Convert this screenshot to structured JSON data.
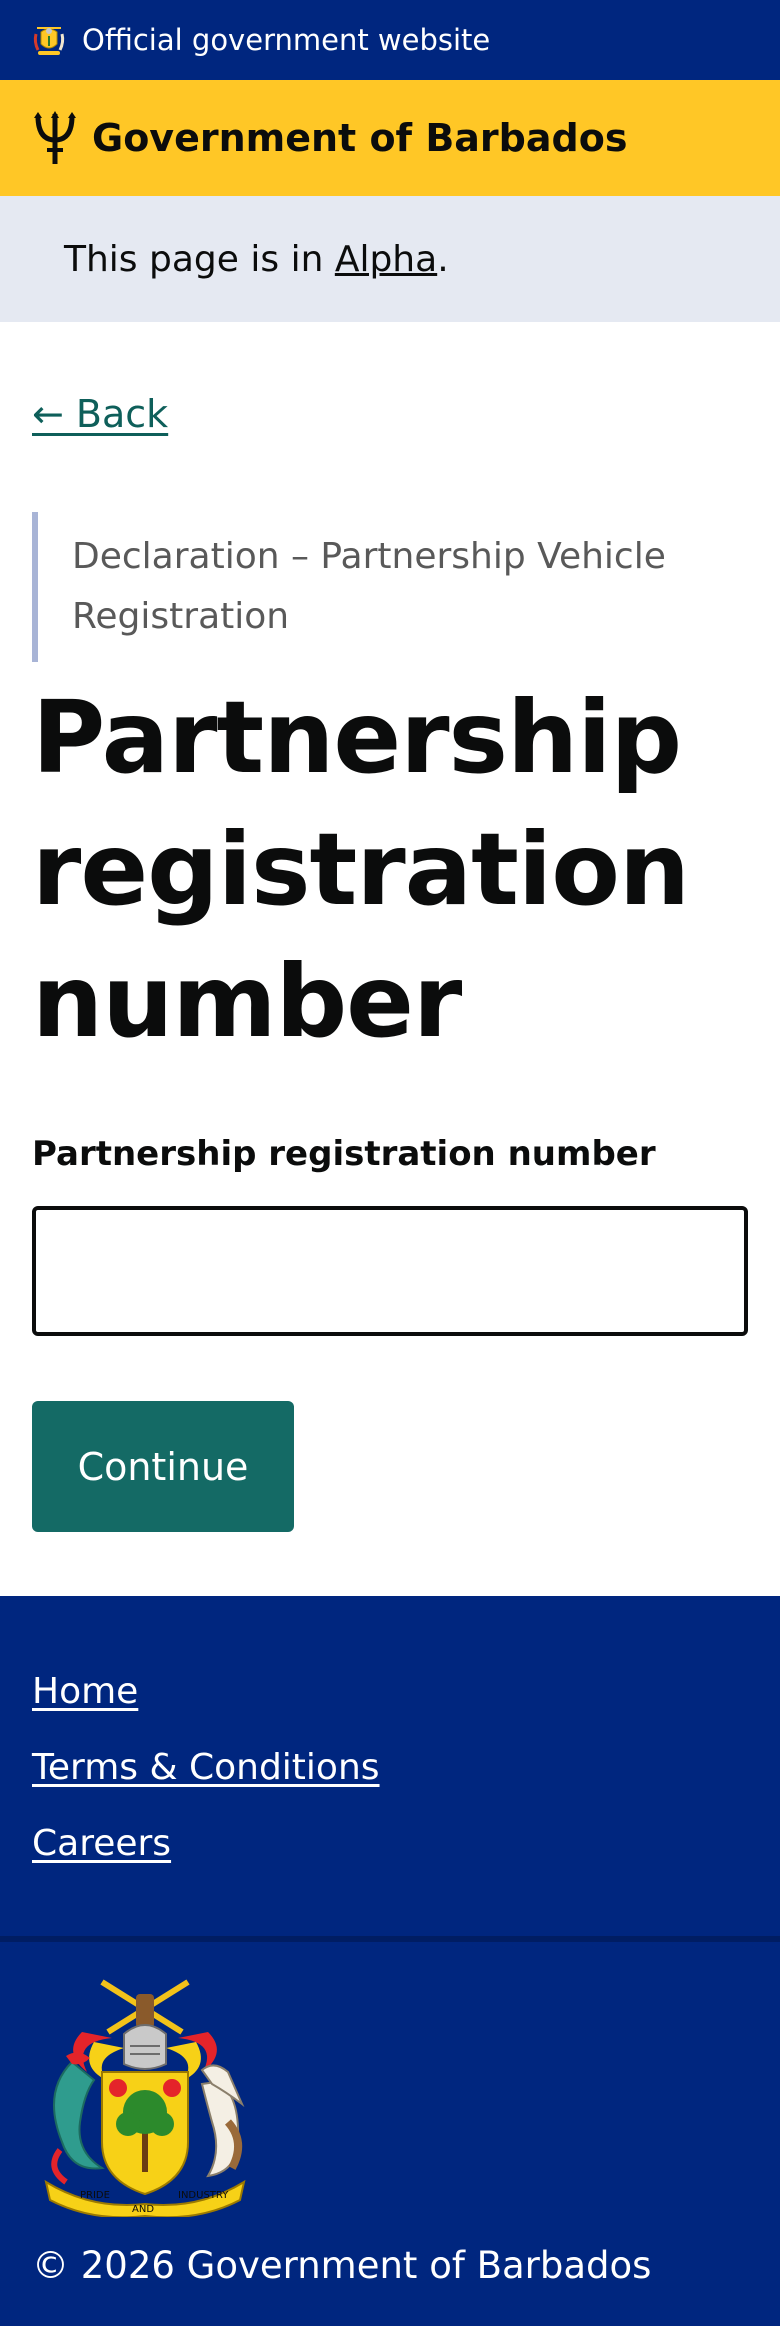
{
  "official_bar": {
    "text": "Official government website",
    "icon": "coat-of-arms-icon"
  },
  "header": {
    "title": "Government of Barbados",
    "icon": "trident-icon"
  },
  "phase_banner": {
    "prefix": "This page is in ",
    "link": "Alpha",
    "suffix": "."
  },
  "main": {
    "back_label": "← Back",
    "caption": "Declaration – Partnership Vehicle Registration",
    "heading": "Partnership registration number",
    "field_label": "Partnership registration number",
    "field_value": "",
    "continue_label": "Continue"
  },
  "footer": {
    "links": [
      "Home",
      "Terms & Conditions",
      "Careers"
    ],
    "crest_motto": [
      "PRIDE",
      "AND",
      "INDUSTRY"
    ],
    "copyright": "© 2026 Government of Barbados"
  },
  "colors": {
    "navy": "#00267f",
    "gold": "#ffc726",
    "teal": "#146a65",
    "link_teal": "#0e5f5a",
    "banner_bg": "#e5e9f2"
  }
}
